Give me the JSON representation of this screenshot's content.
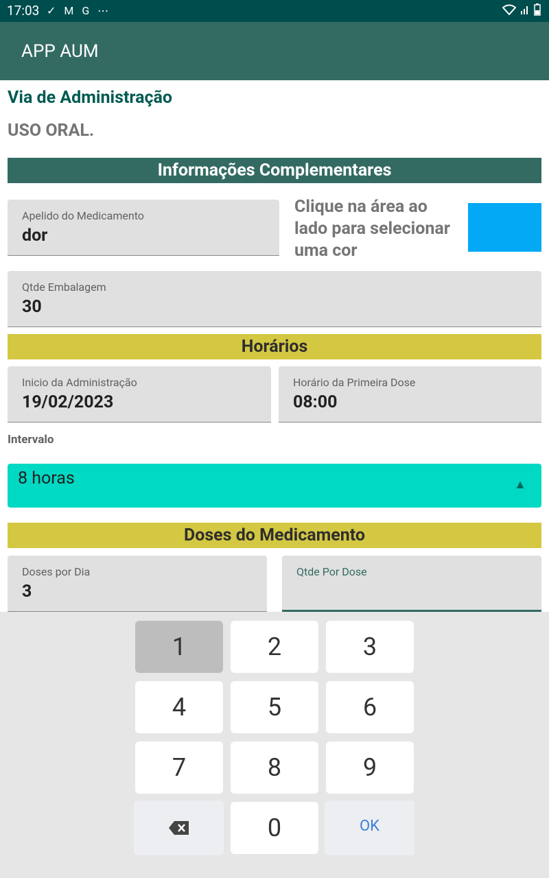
{
  "status_bar": {
    "time": "17:03",
    "left_icons": "✓ M G ⋯"
  },
  "app_bar": {
    "title": "APP AUM"
  },
  "route": {
    "label": "Via de Administração",
    "value": "USO ORAL."
  },
  "complementary": {
    "header": "Informações Complementares",
    "nickname": {
      "label": "Apelido do Medicamento",
      "value": "dor"
    },
    "color_hint": "Clique na área ao lado para selecionar uma cor",
    "color": "#03a9f4",
    "package_qty": {
      "label": "Qtde Embalagem",
      "value": "30"
    }
  },
  "schedule": {
    "header": "Horários",
    "start": {
      "label": "Inicio da Administração",
      "value": "19/02/2023"
    },
    "first_dose": {
      "label": "Horário da Primeira Dose",
      "value": "08:00"
    },
    "interval_label": "Intervalo",
    "interval_value": "8 horas"
  },
  "doses": {
    "header": "Doses do Medicamento",
    "per_day": {
      "label": "Doses por Dia",
      "value": "3"
    },
    "per_dose": {
      "label": "Qtde Por Dose",
      "value": ""
    }
  },
  "keyboard": {
    "keys": [
      "1",
      "2",
      "3",
      "4",
      "5",
      "6",
      "7",
      "8",
      "9",
      "0"
    ],
    "ok_label": "OK",
    "backspace_icon": "backspace-icon"
  }
}
